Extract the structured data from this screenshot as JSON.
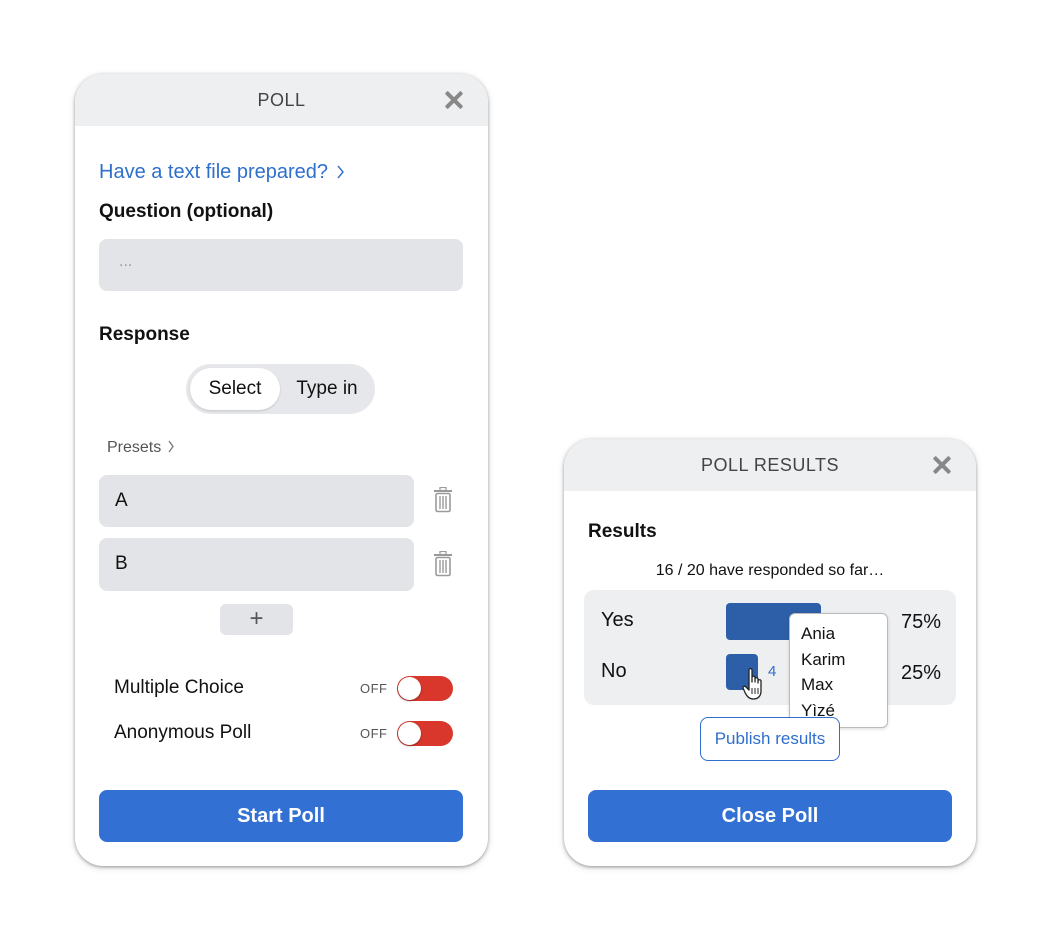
{
  "poll": {
    "title": "POLL",
    "text_file_link": "Have a text file prepared?",
    "question_label": "Question (optional)",
    "question_placeholder": "...",
    "response_label": "Response",
    "response_modes": [
      "Select",
      "Type in"
    ],
    "response_mode_selected": "Select",
    "presets_label": "Presets",
    "options": [
      {
        "value": "A"
      },
      {
        "value": "B"
      }
    ],
    "add_label": "+",
    "toggles": [
      {
        "label": "Multiple Choice",
        "state": "OFF"
      },
      {
        "label": "Anonymous Poll",
        "state": "OFF"
      }
    ],
    "start_label": "Start Poll"
  },
  "results": {
    "title": "POLL RESULTS",
    "heading": "Results",
    "status": "16 / 20 have responded so far…",
    "responded": 16,
    "total": 20,
    "rows": [
      {
        "label": "Yes",
        "percent": "75%",
        "share": 0.75,
        "count_label": ""
      },
      {
        "label": "No",
        "percent": "25%",
        "share": 0.25,
        "count_label": "4"
      }
    ],
    "tooltip_names": [
      "Ania",
      "Karim",
      "Max",
      "Yìzé"
    ],
    "publish_label": "Publish results",
    "close_label": "Close Poll"
  },
  "colors": {
    "accent": "#3370d4",
    "bar": "#2d5fa8",
    "toggle_off": "#d9372c",
    "header_bg": "#eeeff1",
    "field_bg": "#e3e4e7"
  },
  "icons": [
    "close-icon",
    "chevron-right-icon",
    "trash-icon",
    "plus-icon",
    "hand-pointer-icon"
  ]
}
